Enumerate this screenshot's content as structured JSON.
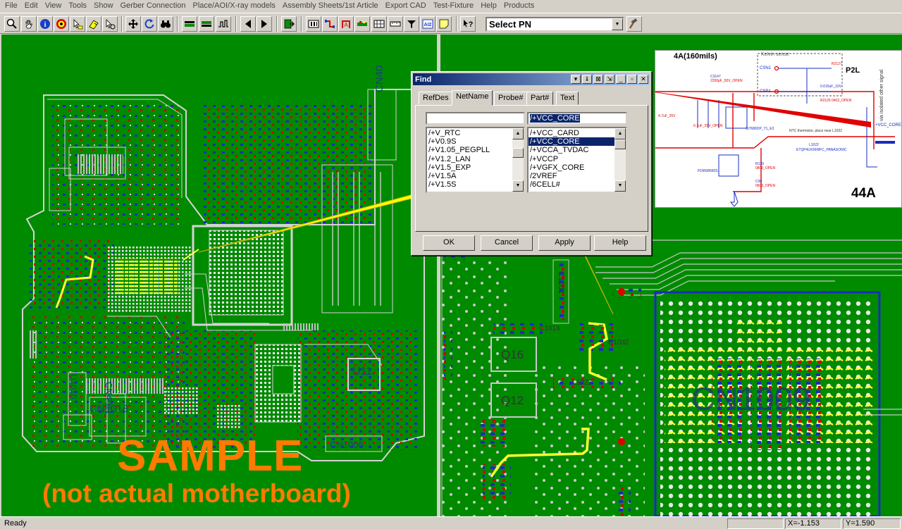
{
  "menu": [
    "File",
    "Edit",
    "View",
    "Tools",
    "Show",
    "Gerber Connection",
    "Place/AOI/X-ray models",
    "Assembly Sheets/1st Article",
    "Export CAD",
    "Test-Fixture",
    "Help",
    "Products"
  ],
  "toolbar": {
    "select_pn": "Select PN",
    "icons": [
      "zoom-icon",
      "hand-icon",
      "info-icon",
      "target-icon",
      "select-arrow-icon",
      "highlight-icon",
      "pick-icon",
      "move-icon",
      "refresh-icon",
      "binoculars-icon",
      "top-side-icon",
      "bottom-side-icon",
      "layers-icon",
      "prev-icon",
      "next-icon",
      "exit-icon",
      "pins-icon",
      "net-icon",
      "trace-icon",
      "comp-icon",
      "grid-icon",
      "ruler-icon",
      "ai2-icon",
      "note-icon",
      "help-cursor-icon"
    ]
  },
  "find_dialog": {
    "title": "Find",
    "tabs": [
      "RefDes",
      "NetName",
      "Probe#",
      "Part#",
      "Text"
    ],
    "active_tab": "NetName",
    "left_input": "",
    "right_input": "/+VCC_CORE",
    "left_list": [
      "/+V_RTC",
      "/+V0.9S",
      "/+V1.05_PEGPLL",
      "/+V1.2_LAN",
      "/+V1.5_EXP",
      "/+V1.5A",
      "/+V1.5S"
    ],
    "right_list": [
      "/+VCC_CARD",
      "/+VCC_CORE",
      "/+VCCA_TVDAC",
      "/+VCCP",
      "/+VGFX_CORE",
      "/2VREF",
      "/6CELL#"
    ],
    "right_selected": "/+VCC_CORE",
    "buttons": [
      "OK",
      "Cancel",
      "Apply",
      "Help"
    ]
  },
  "board_left": {
    "sample_line1": "SAMPLE",
    "sample_line2": "(not actual motherboard)",
    "labels": [
      "CN4011",
      "CN1018",
      "CN1006",
      "U11",
      "U2010",
      "CN40"
    ]
  },
  "board_right": {
    "labels": [
      "Q16",
      "Q12",
      "CN1009",
      "C1201",
      "L1022",
      "C1018",
      "C1032"
    ]
  },
  "schematic": {
    "title": "4A(160mils)",
    "current": "44A",
    "kelvin": "Kelvin sense",
    "csn": "CSN1",
    "csp": "CSP1",
    "p2l": "P2L",
    "vcc_label": "+VCC_CORE",
    "ntc": "NTC thermistor, place near L1022",
    "inductor": "ETQP4LR36WFC_PANASONIC",
    "q10": "SI7686DP_T1_E3",
    "q12": "FDMS8660S",
    "c3147": "C3147",
    "c3147_v": "2200pF_50V_OPEN",
    "r2127": "R2127",
    "r2126": "R2126  0402_OPEN",
    "c2068": "0.015uF_10V",
    "r139": "R139",
    "r139_v": "0805_OPEN",
    "c99": "C99",
    "c99_v": "0603_OPEN",
    "cap1": "4.7uF_25V",
    "cap2": "0.1uF_25V_OPEN",
    "l1022": "L1022",
    "side_note": "via isolated other signal"
  },
  "status": {
    "ready": "Ready",
    "x": "X=-1.153",
    "y": "Y=1.590"
  },
  "colors": {
    "board": "#008a00",
    "trace": "#d4d4d4",
    "pad": "#d00000",
    "via": "#1a2cbf",
    "net_highlight": "#ffff33",
    "sample_text": "#ff7a00",
    "titlebar": "#0a246a"
  }
}
